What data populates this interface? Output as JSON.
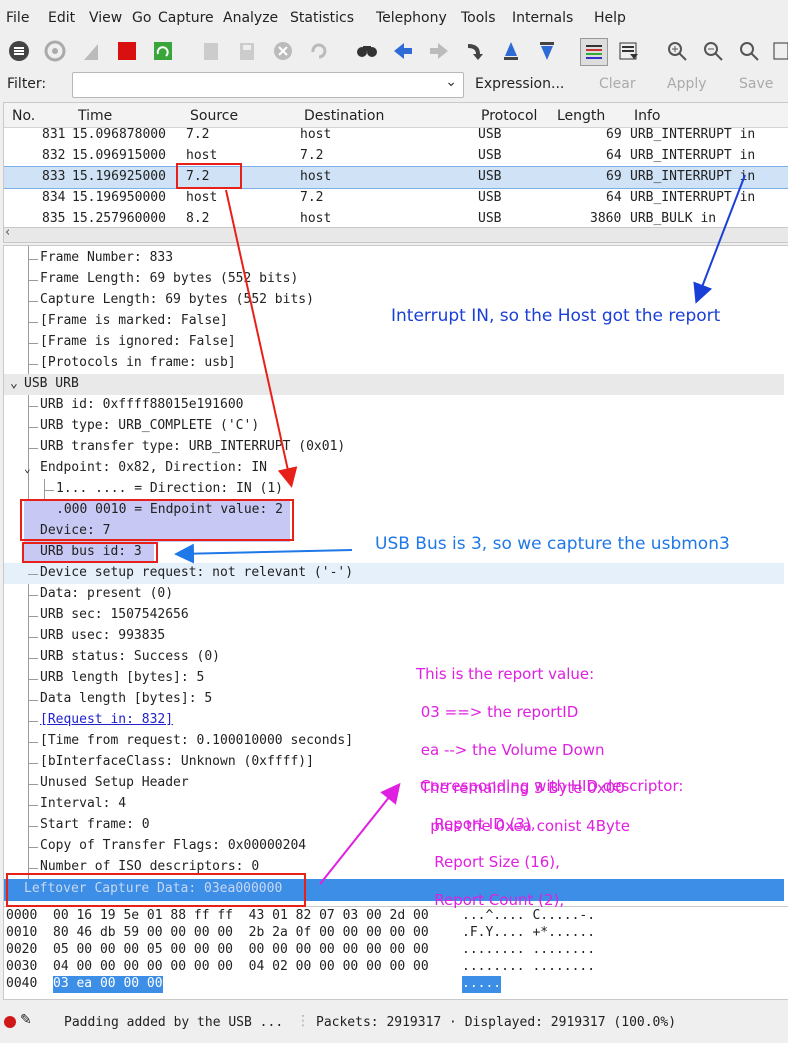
{
  "menu": [
    "File",
    "Edit",
    "View",
    "Go",
    "Capture",
    "Analyze",
    "Statistics",
    "Telephony",
    "Tools",
    "Internals",
    "Help"
  ],
  "toolbar": {
    "icons": [
      "interface-list-icon",
      "capture-options-icon",
      "start-capture-icon",
      "stop-capture-icon",
      "restart-capture-icon",
      "open-file-icon",
      "save-file-icon",
      "close-file-icon",
      "reload-icon",
      "find-packet-icon",
      "go-back-icon",
      "go-forward-icon",
      "go-to-packet-icon",
      "go-first-icon",
      "go-last-icon",
      "colorize-icon",
      "autoscroll-icon",
      "zoom-in-icon",
      "zoom-out-icon",
      "normal-size-icon",
      "resize-columns-icon"
    ]
  },
  "filter": {
    "label": "Filter:",
    "value": "",
    "expression": "Expression...",
    "clear": "Clear",
    "apply": "Apply",
    "save": "Save"
  },
  "packet_list": {
    "columns": [
      "No.",
      "Time",
      "Source",
      "Destination",
      "Protocol",
      "Length",
      "Info"
    ],
    "rows": [
      {
        "no": "831",
        "time": "15.096878000",
        "src": "7.2",
        "dst": "host",
        "proto": "USB",
        "len": "69",
        "info": "URB_INTERRUPT in"
      },
      {
        "no": "832",
        "time": "15.096915000",
        "src": "host",
        "dst": "7.2",
        "proto": "USB",
        "len": "64",
        "info": "URB_INTERRUPT in"
      },
      {
        "no": "833",
        "time": "15.196925000",
        "src": "7.2",
        "dst": "host",
        "proto": "USB",
        "len": "69",
        "info": "URB_INTERRUPT in"
      },
      {
        "no": "834",
        "time": "15.196950000",
        "src": "host",
        "dst": "7.2",
        "proto": "USB",
        "len": "64",
        "info": "URB_INTERRUPT in"
      },
      {
        "no": "835",
        "time": "15.257960000",
        "src": "8.2",
        "dst": "host",
        "proto": "USB",
        "len": "3860",
        "info": "URB_BULK in"
      }
    ]
  },
  "details": {
    "frame": [
      "Frame Number: 833",
      "Frame Length: 69 bytes (552 bits)",
      "Capture Length: 69 bytes (552 bits)",
      "[Frame is marked: False]",
      "[Frame is ignored: False]",
      "[Protocols in frame: usb]"
    ],
    "usb_header": "USB URB",
    "usb_a": [
      "URB id: 0xffff88015e191600",
      "URB type: URB_COMPLETE ('C')",
      "URB transfer type: URB_INTERRUPT (0x01)"
    ],
    "endpoint": "Endpoint: 0x82, Direction: IN",
    "endpoint_dir": "1... .... = Direction: IN (1)",
    "endpoint_val": ".000 0010 = Endpoint value: 2",
    "device": "Device: 7",
    "bus_id": "URB bus id: 3",
    "setup": "Device setup request: not relevant ('-')",
    "usb_b": [
      "Data: present (0)",
      "URB sec: 1507542656",
      "URB usec: 993835",
      "URB status: Success (0)",
      "URB length [bytes]: 5",
      "Data length [bytes]: 5"
    ],
    "request_in": "[Request in: 832]",
    "usb_c": [
      "[Time from request: 0.100010000 seconds]",
      "[bInterfaceClass: Unknown (0xffff)]",
      "Unused Setup Header",
      "Interval: 4",
      "Start frame: 0",
      "Copy of Transfer Flags: 0x00000204",
      "Number of ISO descriptors: 0"
    ],
    "leftover": "Leftover Capture Data: 03ea000000"
  },
  "bytes": {
    "rows": [
      {
        "off": "0000",
        "hex": "00 16 19 5e 01 88 ff ff  43 01 82 07 03 00 2d 00",
        "ascii": "...^.... C.....-."
      },
      {
        "off": "0010",
        "hex": "80 46 db 59 00 00 00 00  2b 2a 0f 00 00 00 00 00",
        "ascii": ".F.Y.... +*......"
      },
      {
        "off": "0020",
        "hex": "05 00 00 00 05 00 00 00  00 00 00 00 00 00 00 00",
        "ascii": "........ ........"
      },
      {
        "off": "0030",
        "hex": "04 00 00 00 00 00 00 00  04 02 00 00 00 00 00 00",
        "ascii": "........ ........"
      },
      {
        "off": "0040",
        "hex": "03 ea 00 00 00",
        "ascii": "....."
      }
    ]
  },
  "status": {
    "expert": "Padding added by the USB ...",
    "packets": "Packets: 2919317 · Displayed: 2919317 (100.0%)"
  },
  "annotations": {
    "interrupt": "Interrupt IN, so the Host got the report",
    "bus": "USB Bus is 3, so we capture the usbmon3",
    "report_lines": [
      "This is the report value:",
      " 03 ==> the reportID",
      " ea --> the Volume Down",
      " The remaining 3 Byte 0x00",
      "   plus the 0xea conist 4Byte"
    ],
    "hid_lines": [
      "Corresponding with HID descriptor:",
      "   Report ID (3),",
      "   Report Size (16),",
      "   Report Count (2),"
    ],
    "colors": {
      "red": "#e8201a",
      "blue": "#1a3fd6",
      "lightblue": "#1f78e8",
      "magenta": "#e020e0"
    }
  }
}
